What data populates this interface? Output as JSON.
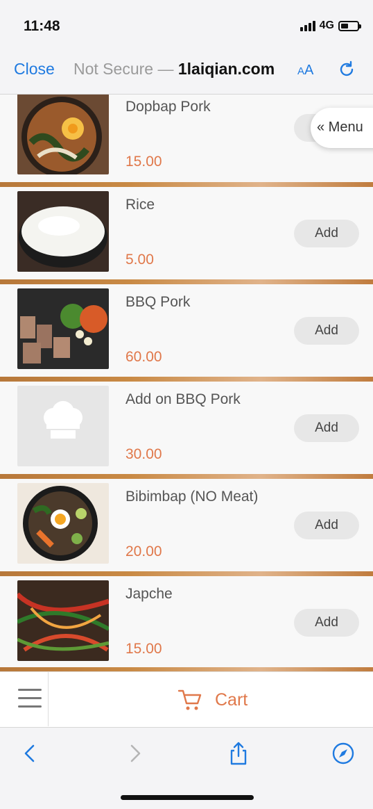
{
  "status": {
    "time": "11:48",
    "network": "4G",
    "battery_level": 0.45
  },
  "browser": {
    "close_label": "Close",
    "url_prefix": "Not Secure — ",
    "url_domain": "1laiqian.com",
    "aa_label_small": "A",
    "aa_label_big": "A"
  },
  "menu_tab": {
    "label": "« Menu"
  },
  "items": [
    {
      "name": "Dopbap Pork",
      "price": "15.00",
      "add_label": "Add",
      "image": "pork-rice-bowl"
    },
    {
      "name": "Rice",
      "price": "5.00",
      "add_label": "Add",
      "image": "rice-bowl"
    },
    {
      "name": "BBQ Pork",
      "price": "60.00",
      "add_label": "Add",
      "image": "bbq-pork-grill"
    },
    {
      "name": "Add on BBQ Pork",
      "price": "30.00",
      "add_label": "Add",
      "image": "chef-hat-placeholder"
    },
    {
      "name": "Bibimbap (NO Meat)",
      "price": "20.00",
      "add_label": "Add",
      "image": "bibimbap-bowl"
    },
    {
      "name": "Japche",
      "price": "15.00",
      "add_label": "Add",
      "image": "japchae-noodles"
    }
  ],
  "cart": {
    "label": "Cart"
  },
  "colors": {
    "accent": "#e0784a",
    "link": "#1f7ae0",
    "divider": "#c98a45"
  }
}
